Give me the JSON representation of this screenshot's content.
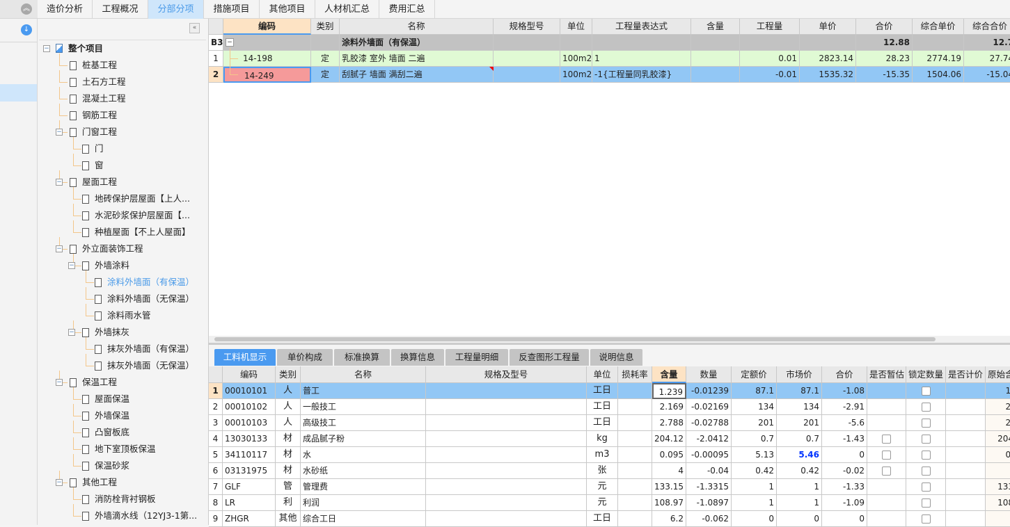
{
  "colors": {
    "accent": "#4a9af0",
    "selected_row": "#92c7f5",
    "green_row": "#e0fad4",
    "group_row": "#c2c2c2",
    "code_red": "#f59a9a",
    "blue_value": "#0033ff"
  },
  "top_tabs": [
    {
      "label": "造价分析"
    },
    {
      "label": "工程概况"
    },
    {
      "label": "分部分项",
      "active": true
    },
    {
      "label": "措施项目"
    },
    {
      "label": "其他项目"
    },
    {
      "label": "人材机汇总"
    },
    {
      "label": "费用汇总"
    }
  ],
  "strip_icons": [
    "collapse-up-icon",
    "download-icon"
  ],
  "tree": [
    {
      "label": "整个项目",
      "level": 0,
      "expander": true,
      "icon": "project-icon"
    },
    {
      "label": "桩基工程",
      "level": 1
    },
    {
      "label": "土石方工程",
      "level": 1
    },
    {
      "label": "混凝土工程",
      "level": 1
    },
    {
      "label": "钢筋工程",
      "level": 1
    },
    {
      "label": "门窗工程",
      "level": 1,
      "expander": true
    },
    {
      "label": "门",
      "level": 2
    },
    {
      "label": "窗",
      "level": 2
    },
    {
      "label": "屋面工程",
      "level": 1,
      "expander": true
    },
    {
      "label": "地砖保护层屋面【上人...",
      "level": 2
    },
    {
      "label": "水泥砂浆保护层屋面【...",
      "level": 2
    },
    {
      "label": "种植屋面【不上人屋面】",
      "level": 2
    },
    {
      "label": "外立面装饰工程",
      "level": 1,
      "expander": true
    },
    {
      "label": "外墙涂料",
      "level": 2,
      "expander": true
    },
    {
      "label": "涂料外墙面（有保温）",
      "level": 3,
      "selected": true
    },
    {
      "label": "涂料外墙面（无保温）",
      "level": 3
    },
    {
      "label": "涂料雨水管",
      "level": 3
    },
    {
      "label": "外墙抹灰",
      "level": 2,
      "expander": true
    },
    {
      "label": "抹灰外墙面（有保温）",
      "level": 3
    },
    {
      "label": "抹灰外墙面（无保温）",
      "level": 3
    },
    {
      "label": "保温工程",
      "level": 1,
      "expander": true
    },
    {
      "label": "屋面保温",
      "level": 2
    },
    {
      "label": "外墙保温",
      "level": 2
    },
    {
      "label": "凸窗板底",
      "level": 2
    },
    {
      "label": "地下室顶板保温",
      "level": 2
    },
    {
      "label": "保温砂浆",
      "level": 2
    },
    {
      "label": "其他工程",
      "level": 1,
      "expander": true
    },
    {
      "label": "消防栓背衬钢板",
      "level": 2
    },
    {
      "label": "外墙滴水线（12YJ3-1第...",
      "level": 2
    }
  ],
  "top_grid": {
    "headers": [
      "",
      "编码",
      "类别",
      "名称",
      "规格型号",
      "单位",
      "工程量表达式",
      "含量",
      "工程量",
      "单价",
      "合价",
      "综合单价",
      "综合合价"
    ],
    "rows": [
      {
        "type": "group",
        "cells": [
          "B3",
          "",
          "",
          "涂料外墙面（有保温）",
          "",
          "",
          "",
          "",
          "",
          "",
          "12.88",
          "",
          "12.7"
        ]
      },
      {
        "type": "item",
        "cells": [
          "1",
          "14-198",
          "定",
          "乳胶漆 室外 墙面 二遍",
          "",
          "100m2",
          "1",
          "",
          "0.01",
          "2823.14",
          "28.23",
          "2774.19",
          "27.74"
        ]
      },
      {
        "type": "selected",
        "cells": [
          "2",
          "14-249",
          "定",
          "刮腻子 墙面 满刮二遍",
          "",
          "100m2",
          "-1{工程量同乳胶漆}",
          "",
          "-0.01",
          "1535.32",
          "-15.35",
          "1504.06",
          "-15.04"
        ]
      }
    ]
  },
  "bottom_tabs": [
    {
      "label": "工料机显示",
      "active": true
    },
    {
      "label": "单价构成"
    },
    {
      "label": "标准换算"
    },
    {
      "label": "换算信息"
    },
    {
      "label": "工程量明细"
    },
    {
      "label": "反查图形工程量"
    },
    {
      "label": "说明信息"
    }
  ],
  "bottom_grid": {
    "headers": [
      "",
      "编码",
      "类别",
      "名称",
      "规格及型号",
      "单位",
      "损耗率",
      "含量",
      "数量",
      "定额价",
      "市场价",
      "合价",
      "是否暂估",
      "锁定数量",
      "是否计价",
      "原始含"
    ],
    "rows": [
      {
        "cells": [
          "1",
          "00010101",
          "人",
          "普工",
          "",
          "工日",
          "",
          "1.239",
          "-0.01239",
          "87.1",
          "87.1",
          "-1.08",
          "",
          "",
          "",
          "1."
        ],
        "est": false,
        "lock": true
      },
      {
        "cells": [
          "2",
          "00010102",
          "人",
          "一般技工",
          "",
          "工日",
          "",
          "2.169",
          "-0.02169",
          "134",
          "134",
          "-2.91",
          "",
          "",
          "",
          "2."
        ],
        "est": false,
        "lock": true
      },
      {
        "cells": [
          "3",
          "00010103",
          "人",
          "高级技工",
          "",
          "工日",
          "",
          "2.788",
          "-0.02788",
          "201",
          "201",
          "-5.6",
          "",
          "",
          "",
          "2."
        ],
        "est": false,
        "lock": true
      },
      {
        "cells": [
          "4",
          "13030133",
          "材",
          "成品腻子粉",
          "",
          "kg",
          "",
          "204.12",
          "-2.0412",
          "0.7",
          "0.7",
          "-1.43",
          "",
          "",
          "",
          "204"
        ],
        "est": true,
        "lock": true
      },
      {
        "cells": [
          "5",
          "34110117",
          "材",
          "水",
          "",
          "m3",
          "",
          "0.095",
          "-0.00095",
          "5.13",
          "5.46",
          "0",
          "",
          "",
          "",
          "0."
        ],
        "est": true,
        "lock": true,
        "blue_market": true
      },
      {
        "cells": [
          "6",
          "03131975",
          "材",
          "水砂纸",
          "",
          "张",
          "",
          "4",
          "-0.04",
          "0.42",
          "0.42",
          "-0.02",
          "",
          "",
          "",
          ""
        ],
        "est": true,
        "lock": true
      },
      {
        "cells": [
          "7",
          "GLF",
          "管",
          "管理费",
          "",
          "元",
          "",
          "133.15",
          "-1.3315",
          "1",
          "1",
          "-1.33",
          "",
          "",
          "",
          "133"
        ],
        "est": false,
        "lock": true
      },
      {
        "cells": [
          "8",
          "LR",
          "利",
          "利润",
          "",
          "元",
          "",
          "108.97",
          "-1.0897",
          "1",
          "1",
          "-1.09",
          "",
          "",
          "",
          "108"
        ],
        "est": false,
        "lock": true
      },
      {
        "cells": [
          "9",
          "ZHGR",
          "其他",
          "综合工日",
          "",
          "工日",
          "",
          "6.2",
          "-0.062",
          "0",
          "0",
          "0",
          "",
          "",
          "",
          ""
        ],
        "est": false,
        "lock": true
      }
    ]
  }
}
